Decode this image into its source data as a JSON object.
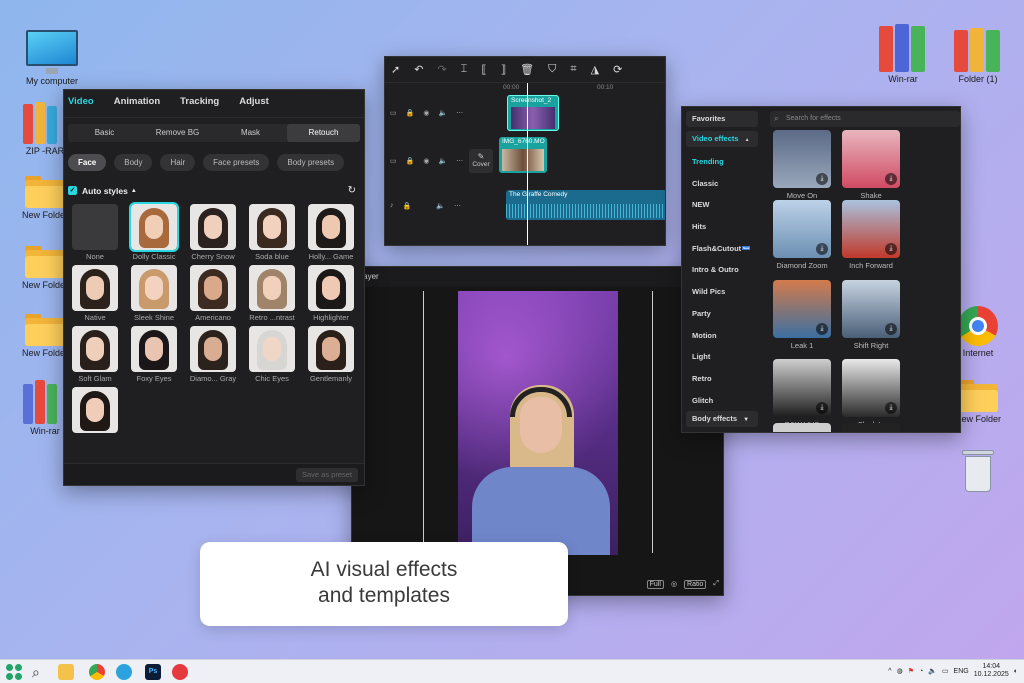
{
  "desktop_left": [
    "My computer",
    "ZIP -RAR",
    "New Folder",
    "New Folder",
    "New Folder",
    "Win-rar"
  ],
  "desktop_right": [
    "Win-rar",
    "Folder (1)",
    "Internet",
    "New Folder"
  ],
  "retouch": {
    "tabs": [
      "Video",
      "Animation",
      "Tracking",
      "Adjust"
    ],
    "subtabs": [
      "Basic",
      "Remove BG",
      "Mask",
      "Retouch"
    ],
    "pills": [
      "Face",
      "Body",
      "Hair",
      "Face presets",
      "Body presets"
    ],
    "auto_styles": "Auto styles",
    "styles": [
      "None",
      "Dolly Classic",
      "Cherry Snow",
      "Soda blue",
      "Holly... Game",
      "Native",
      "Sleek Shine",
      "Americano",
      "Retro ...ntrast",
      "Highlighter",
      "Soft Glam",
      "Foxy Eyes",
      "Diamo... Gray",
      "Chic Eyes",
      "Gentlemanly",
      ""
    ],
    "save_preset": "Save as preset"
  },
  "timeline": {
    "tick_start": "00:00",
    "tick_10": "00:10",
    "cover": "Cover",
    "clip1": "Screenshot_2",
    "clip2": "IMG_6760.MO",
    "audio": "The Giraffe Comedy"
  },
  "player": {
    "title": "Player",
    "full": "Full",
    "ratio": "Ratio"
  },
  "effects": {
    "sidebar": [
      "Favorites",
      "Video effects",
      "Trending",
      "Classic",
      "NEW",
      "Hits",
      "Flash&Cutout",
      "Intro & Outro",
      "Wild Pics",
      "Party",
      "Motion",
      "Light",
      "Retro",
      "Glitch",
      "Body effects"
    ],
    "new_badge": "New",
    "search_placeholder": "Search for effects",
    "items": [
      "Move On",
      "Shake",
      "Diamond Zoom",
      "Inch Forward",
      "Leak 1",
      "Shift Right",
      "B&W VHS",
      "Clack In"
    ]
  },
  "caption": {
    "line1": "AI visual effects",
    "line2": "and templates"
  },
  "taskbar": {
    "time": "14:04",
    "date": "10.12.2025",
    "lang": "ENG"
  },
  "colors": {
    "accent": "#2ad6e0",
    "panel_bg": "#1f1f21"
  }
}
